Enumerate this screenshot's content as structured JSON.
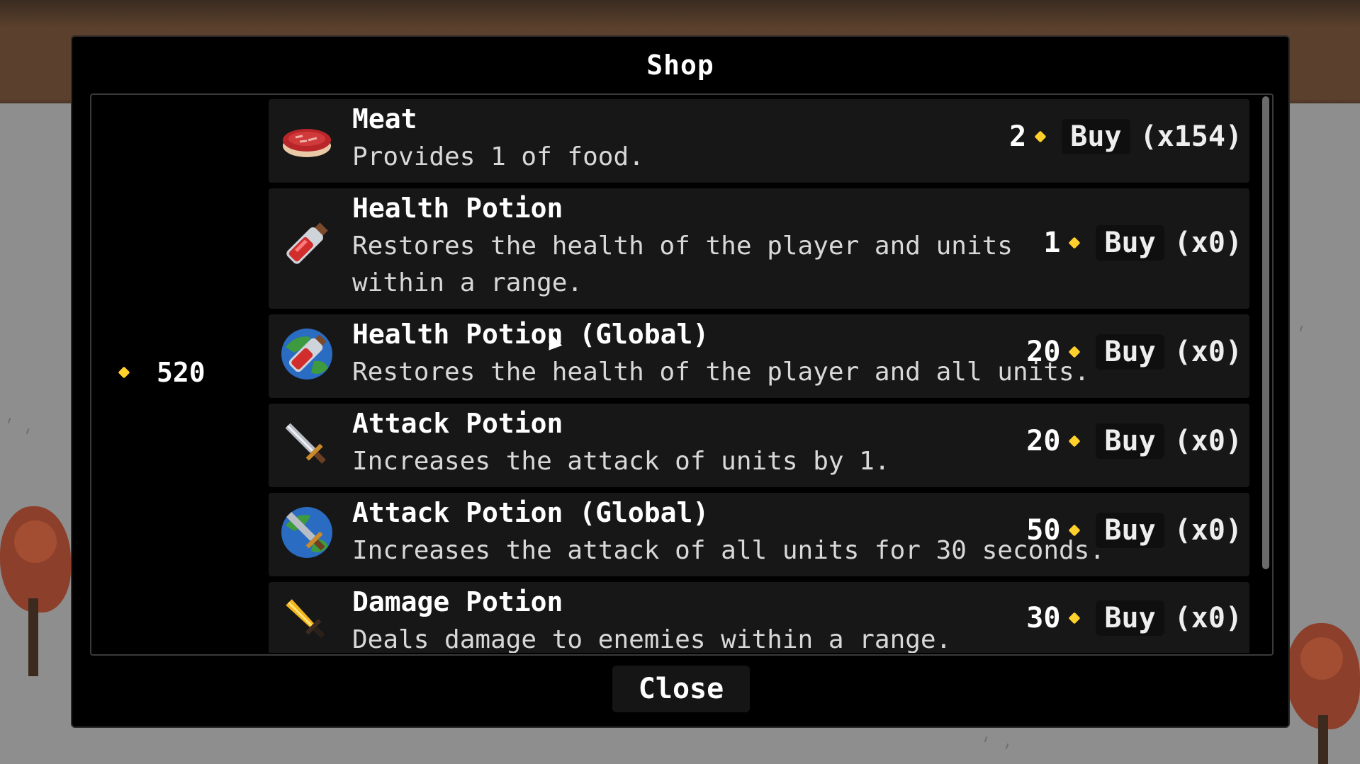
{
  "shop": {
    "title": "Shop",
    "gold": "520",
    "close_label": "Close",
    "currency_icon": "gold-coin-icon",
    "currency_color": "#ffd12a",
    "items": [
      {
        "name": "Meat",
        "description": "Provides 1 of food.",
        "price": "2",
        "buy_label": "Buy",
        "count": "(x154)",
        "icon": "meat-icon"
      },
      {
        "name": "Health Potion",
        "description": "Restores the health of the player and units within a range.",
        "price": "1",
        "buy_label": "Buy",
        "count": "(x0)",
        "icon": "health-potion-icon"
      },
      {
        "name": "Health Potion (Global)",
        "description": "Restores the health of the player and all units.",
        "price": "20",
        "buy_label": "Buy",
        "count": "(x0)",
        "icon": "global-health-potion-icon"
      },
      {
        "name": "Attack Potion",
        "description": "Increases the attack of units by 1.",
        "price": "20",
        "buy_label": "Buy",
        "count": "(x0)",
        "icon": "sword-icon"
      },
      {
        "name": "Attack Potion (Global)",
        "description": "Increases the attack of all units for 30 seconds.",
        "price": "50",
        "buy_label": "Buy",
        "count": "(x0)",
        "icon": "global-sword-icon"
      },
      {
        "name": "Damage Potion",
        "description": "Deals damage to enemies within a range.",
        "price": "30",
        "buy_label": "Buy",
        "count": "(x0)",
        "icon": "golden-dagger-icon"
      }
    ]
  }
}
